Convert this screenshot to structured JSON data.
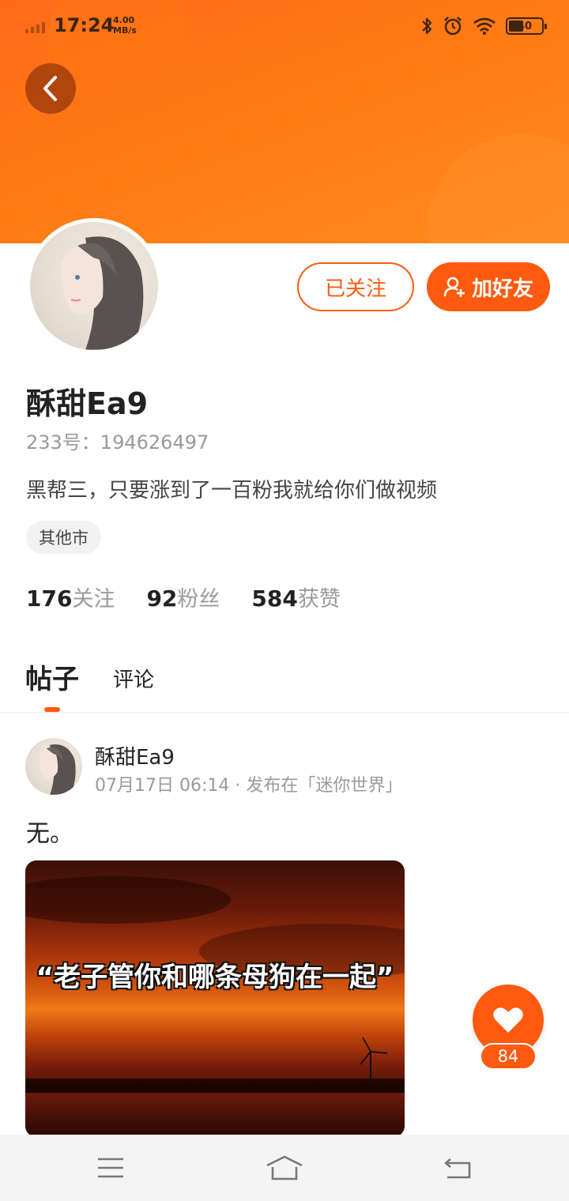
{
  "status_bar": {
    "time": "17:24",
    "net_speed_value": "4.00",
    "net_speed_unit": "MB/s",
    "battery_level": "40",
    "icons": [
      "signal-icon",
      "bluetooth-icon",
      "alarm-icon",
      "wifi-icon",
      "battery-icon"
    ]
  },
  "header": {
    "back_icon": "chevron-left-icon",
    "accent_color": "#ff5a10"
  },
  "profile": {
    "username": "酥甜Ea9",
    "user_id": "233号：194626497",
    "bio": "黑帮三，只要涨到了一百粉我就给你们做视频",
    "location_tag": "其他市",
    "follow_label": "已关注",
    "add_friend_label": "加好友",
    "add_friend_icon": "add-user-icon"
  },
  "stats": {
    "following_count": "176",
    "following_label": "关注",
    "followers_count": "92",
    "followers_label": "粉丝",
    "likes_count": "584",
    "likes_label": "获赞"
  },
  "tabs": {
    "posts_label": "帖子",
    "comments_label": "评论",
    "active": "帖子"
  },
  "post": {
    "author": "酥甜Ea9",
    "meta": "07月17日 06:14 · 发布在「迷你世界」",
    "text": "无。",
    "image_caption": "“老子管你和哪条母狗在一起”"
  },
  "like": {
    "icon": "heart-icon",
    "count": "84"
  },
  "nav_bar": {
    "icons": [
      "menu-icon",
      "home-icon",
      "back-arrow-icon"
    ]
  }
}
